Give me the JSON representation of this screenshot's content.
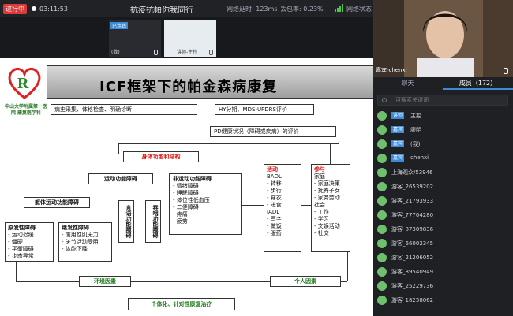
{
  "topbar": {
    "recording": "进行中",
    "timer": "03:11:53",
    "meeting_title": "抗疫抗帕你我同行",
    "latency": "网络延时: 123ms",
    "packet_loss": "丢包率: 0.23%",
    "network_status": "网络状态"
  },
  "thumbs": [
    {
      "tag": "已连线",
      "name": "(我)"
    },
    {
      "name": "讲师-主控"
    }
  ],
  "slide": {
    "logo_text": "中山大学附属第一医院 康复医学科",
    "title": "ICF框架下的帕金森病康复",
    "box_history": "病史采集、体格检查、明确诊断",
    "box_hy": "HY分期、MDS-UPDRS评价",
    "box_pd": "PD健康状况（障碍或疾病）的评价",
    "box_body": "身体功能和结构",
    "box_motor": "运动功能障碍",
    "box_nonmotor": "非运动功能障碍",
    "nonmotor_items": [
      "- 情绪障碍",
      "- 睡眠障碍",
      "- 体位性低血压",
      "- 二便障碍",
      "- 疼痛",
      "- 疲劳"
    ],
    "box_trunk": "躯体运动功能障碍",
    "box_speech": "言语功能障碍",
    "box_swallow": "吞咽功能障碍",
    "box_primary": "原发性障碍",
    "primary_items": [
      "- 运动迟缓",
      "- 僵硬",
      "- 平衡障碍",
      "- 步态异常"
    ],
    "box_secondary": "继发性障碍",
    "secondary_items": [
      "- 废用性肌无力",
      "- 关节活动受阻",
      "- 体能下降"
    ],
    "box_activity": "活动",
    "activity_items": [
      "BADL",
      "- 转移",
      "- 步行",
      "- 穿衣",
      "- 进食",
      "IADL",
      "- 写字",
      "- 做饭",
      "- 服药"
    ],
    "box_participation": "参与",
    "participation_items": [
      "家庭",
      "- 家庭决策",
      "- 抚养子女",
      "- 家务劳动",
      "社会",
      "- 工作",
      "- 学习",
      "- 文娱活动",
      "- 社交"
    ],
    "box_env": "环境因素",
    "box_personal": "个人因素",
    "box_plan": "个体化、针对性康复治疗"
  },
  "panel": {
    "speaker_label": "嘉宾-chenxi",
    "tabs": [
      "聊天",
      "成员（172）"
    ],
    "search_placeholder": "可搜索关键词",
    "members": [
      {
        "role": "讲师",
        "name": "主控"
      },
      {
        "role": "嘉宾",
        "name": "廖明"
      },
      {
        "role": "嘉宾",
        "name": "(我)"
      },
      {
        "role": "嘉宾",
        "name": "chenxi"
      },
      {
        "role": "",
        "name": "上海观众/53946"
      },
      {
        "role": "",
        "name": "游客_26539202"
      },
      {
        "role": "",
        "name": "游客_21793933"
      },
      {
        "role": "",
        "name": "游客_77704280"
      },
      {
        "role": "",
        "name": "游客_87309836"
      },
      {
        "role": "",
        "name": "游客_66002345"
      },
      {
        "role": "",
        "name": "游客_21206052"
      },
      {
        "role": "",
        "name": "游客_89540949"
      },
      {
        "role": "",
        "name": "游客_25229736"
      },
      {
        "role": "",
        "name": "游客_18258062"
      }
    ]
  },
  "colors": {
    "accent": "#3c8bd9",
    "record": "#d93a3a",
    "title_red": "#dd1111"
  }
}
